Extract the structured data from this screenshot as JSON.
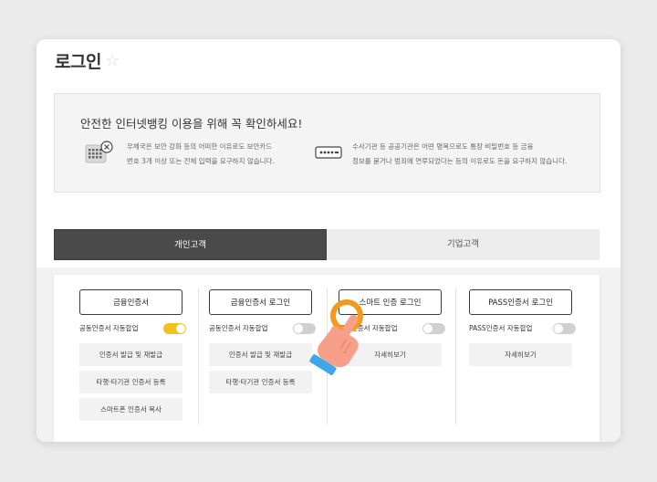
{
  "page": {
    "title": "로그인",
    "favorite_icon": "star-icon"
  },
  "notice": {
    "title": "안전한 인터넷뱅킹 이용을 위해 꼭 확인하세요!",
    "items": [
      {
        "icon": "security-card-icon",
        "line1": "우체국은 보안 강화 등의 어떠한 이유로도 보안카드",
        "line2": "번호 3개 이상 또는 전체 입력을 요구하지 않습니다."
      },
      {
        "icon": "password-icon",
        "line1": "수사기관 등 공공기관은 어떤 명목으로도 통장 비밀번호 등 금융",
        "line2": "정보를 묻거나 범죄에 연루되었다는 등의 이유로도 돈을 요구하지 않습니다."
      }
    ]
  },
  "tabs": [
    {
      "label": "개인고객",
      "active": true
    },
    {
      "label": "기업고객",
      "active": false
    }
  ],
  "methods": [
    {
      "main": "금융인증서",
      "toggle_label": "공동인증서 자동합업",
      "toggle_on": true,
      "sub": [
        "인증서 발급 및 재발급",
        "타행·타기관 인증서 등록",
        "스마트폰 인증서 복사"
      ]
    },
    {
      "main": "금융인증서 로그인",
      "toggle_label": "공동인증서 자동합업",
      "toggle_on": false,
      "sub": [
        "인증서 발급 및 재발급",
        "타행·타기관 인증서 등록"
      ]
    },
    {
      "main": "스마트 인증 로그인",
      "toggle_label": "공동인증서 자동합업",
      "toggle_on": false,
      "sub": [
        "자세히보기"
      ]
    },
    {
      "main": "PASS인증서 로그인",
      "toggle_label": "PASS인증서 자동합업",
      "toggle_on": false,
      "sub": [
        "자세히보기"
      ]
    }
  ],
  "colors": {
    "active_tab": "#4a4a4a",
    "toggle_on": "#f1c21a",
    "pointer_ring": "#f39a1e",
    "hand": "#f6a08a",
    "cuff": "#3fa6e8"
  },
  "pointer_icon": "hand-pointer-icon"
}
